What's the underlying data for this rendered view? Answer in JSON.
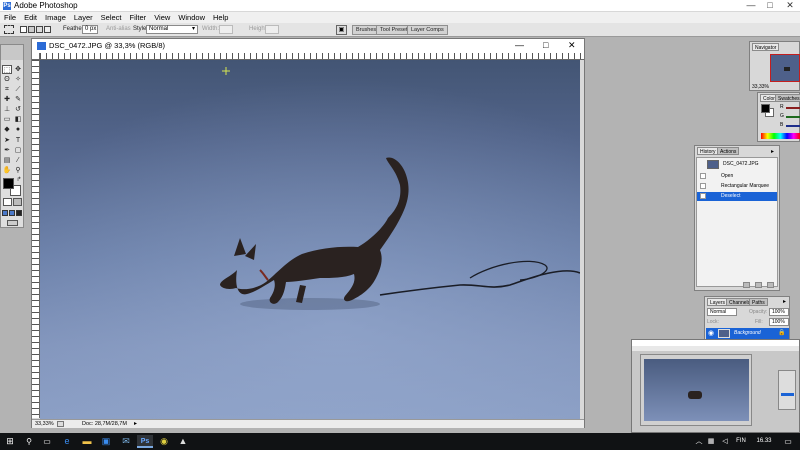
{
  "app": {
    "title": "Adobe Photoshop"
  },
  "window_controls": {
    "min": "—",
    "max": "□",
    "close": "✕"
  },
  "menu": [
    "File",
    "Edit",
    "Image",
    "Layer",
    "Select",
    "Filter",
    "View",
    "Window",
    "Help"
  ],
  "options": {
    "feather_label": "Feather:",
    "feather_value": "0 px",
    "antialias_label": "Anti-alias",
    "style_label": "Style:",
    "style_value": "Normal",
    "width_label": "Width:",
    "height_label": "Height:",
    "tabs": [
      "Brushes",
      "Tool Presets",
      "Layer Comps"
    ]
  },
  "document": {
    "title": "DSC_0472.JPG @ 33,3% (RGB/8)",
    "zoom": "33,33%",
    "doc_size": "Doc: 28,7M/28,7M"
  },
  "navigator": {
    "tabs": [
      "Navigator"
    ],
    "zoom": "33,33%"
  },
  "color": {
    "tabs": [
      "Color",
      "Swatches"
    ],
    "channels": [
      "R",
      "G",
      "B"
    ]
  },
  "history": {
    "tabs": [
      "History",
      "Actions"
    ],
    "snapshot": "DSC_0472.JPG",
    "items": [
      "Open",
      "Rectangular Marquee",
      "Deselect"
    ],
    "selected_index": 2
  },
  "layers": {
    "tabs": [
      "Layers",
      "Channels",
      "Paths"
    ],
    "blend_mode": "Normal",
    "opacity_label": "Opacity:",
    "opacity": "100%",
    "lock_label": "Lock:",
    "fill_label": "Fill:",
    "fill": "100%",
    "items": [
      "Background"
    ]
  },
  "taskbar": {
    "language": "FIN",
    "time": "16.33"
  },
  "colors": {
    "selected_row": "#1a63d6",
    "taskbar": "#101214"
  }
}
